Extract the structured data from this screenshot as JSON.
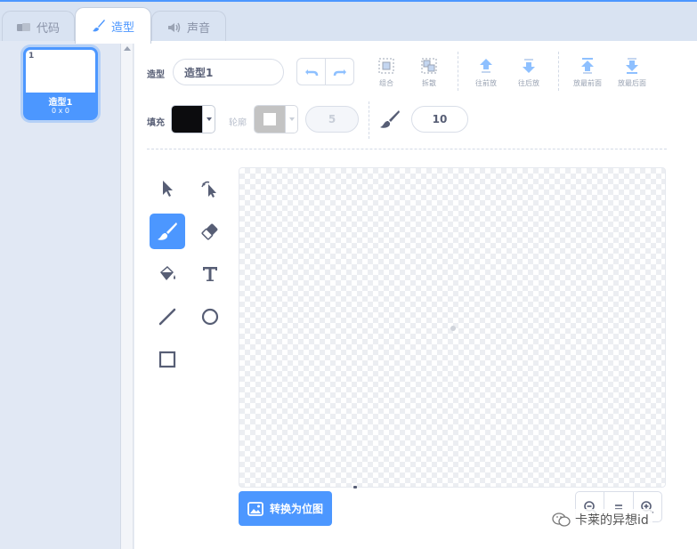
{
  "tabs": [
    {
      "label": "代码",
      "icon": "code-icon",
      "active": false
    },
    {
      "label": "造型",
      "icon": "paintbrush-icon",
      "active": true
    },
    {
      "label": "声音",
      "icon": "speaker-icon",
      "active": false
    }
  ],
  "costume_list": {
    "items": [
      {
        "number": "1",
        "name": "造型1",
        "size": "0 x 0",
        "selected": true
      }
    ]
  },
  "toolbar": {
    "costume_label": "造型",
    "costume_name": "造型1",
    "actions": [
      {
        "label": "组合",
        "icon": "group-icon"
      },
      {
        "label": "拆散",
        "icon": "ungroup-icon"
      },
      {
        "label": "往前放",
        "icon": "forward-icon"
      },
      {
        "label": "往后放",
        "icon": "backward-icon"
      },
      {
        "label": "放最前面",
        "icon": "front-icon"
      },
      {
        "label": "放最后面",
        "icon": "back-icon"
      }
    ],
    "fill_label": "填充",
    "fill_color": "#0c0c0e",
    "outline_label": "轮廓",
    "outline_color": "#b0b0b0",
    "outline_width": "5",
    "brush_size": "10"
  },
  "tools": [
    {
      "name": "select",
      "icon": "arrow-select-icon"
    },
    {
      "name": "reshape",
      "icon": "reshape-icon"
    },
    {
      "name": "brush",
      "icon": "brush-icon",
      "active": true
    },
    {
      "name": "eraser",
      "icon": "eraser-icon"
    },
    {
      "name": "fill",
      "icon": "fill-bucket-icon"
    },
    {
      "name": "text",
      "icon": "text-icon"
    },
    {
      "name": "line",
      "icon": "line-icon"
    },
    {
      "name": "circle",
      "icon": "circle-icon"
    },
    {
      "name": "rectangle",
      "icon": "rectangle-icon"
    }
  ],
  "canvas": {
    "convert_button": "转换为位图"
  },
  "watermark": "卡莱的异想id"
}
